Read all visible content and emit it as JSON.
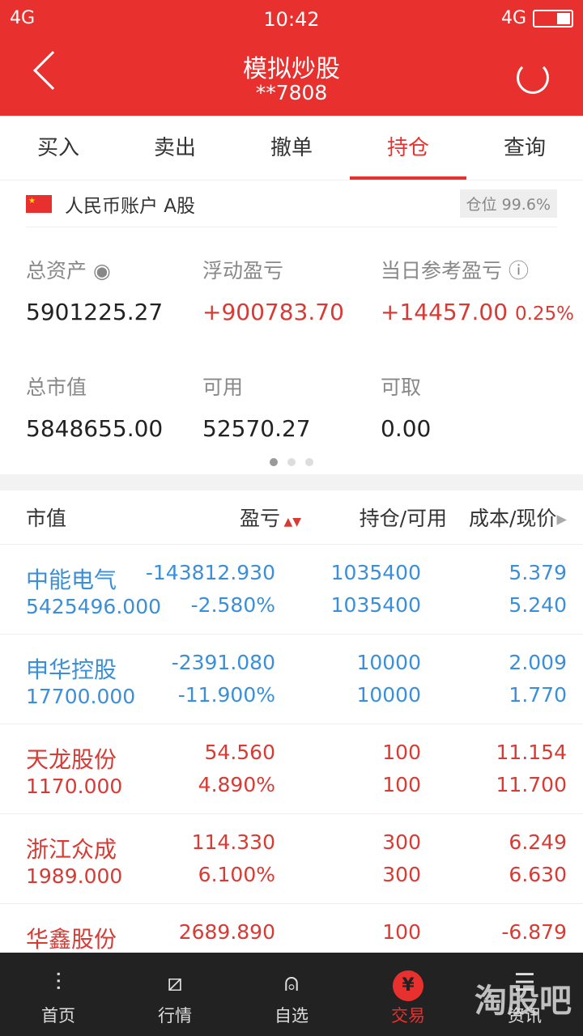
{
  "status": {
    "network": "4G",
    "time": "10:42",
    "network_right": "4G"
  },
  "header": {
    "title": "模拟炒股",
    "account": "**7808"
  },
  "tabs": [
    "买入",
    "卖出",
    "撤单",
    "持仓",
    "查询"
  ],
  "active_tab": 3,
  "account": {
    "name": "人民币账户 A股",
    "position": "仓位 99.6%"
  },
  "stats": {
    "total_assets_label": "总资产",
    "total_assets": "5901225.27",
    "float_pl_label": "浮动盈亏",
    "float_pl": "+900783.70",
    "daily_pl_label": "当日参考盈亏",
    "daily_pl": "+14457.00",
    "daily_pct": "0.25%",
    "market_value_label": "总市值",
    "market_value": "5848655.00",
    "available_label": "可用",
    "available": "52570.27",
    "withdrawable_label": "可取",
    "withdrawable": "0.00"
  },
  "table": {
    "headers": [
      "市值",
      "盈亏",
      "持仓/可用",
      "成本/现价"
    ],
    "rows": [
      {
        "name": "中能电气",
        "mv": "5425496.000",
        "pl": "-143812.930",
        "pct": "-2.580%",
        "hold": "1035400",
        "avail": "1035400",
        "cost": "5.379",
        "price": "5.240",
        "color": "#3b8fd9"
      },
      {
        "name": "申华控股",
        "mv": "17700.000",
        "pl": "-2391.080",
        "pct": "-11.900%",
        "hold": "10000",
        "avail": "10000",
        "cost": "2.009",
        "price": "1.770",
        "color": "#3b8fd9"
      },
      {
        "name": "天龙股份",
        "mv": "1170.000",
        "pl": "54.560",
        "pct": "4.890%",
        "hold": "100",
        "avail": "100",
        "cost": "11.154",
        "price": "11.700",
        "color": "#d83a34"
      },
      {
        "name": "浙江众成",
        "mv": "1989.000",
        "pl": "114.330",
        "pct": "6.100%",
        "hold": "300",
        "avail": "300",
        "cost": "6.249",
        "price": "6.630",
        "color": "#d83a34"
      },
      {
        "name": "华鑫股份",
        "mv": "",
        "pl": "2689.890",
        "pct": "",
        "hold": "100",
        "avail": "",
        "cost": "-6.879",
        "price": "",
        "color": "#d83a34"
      }
    ]
  },
  "nav": [
    "首页",
    "行情",
    "自选",
    "交易",
    "资讯"
  ],
  "nav_active": 3,
  "watermark": "淘股吧"
}
